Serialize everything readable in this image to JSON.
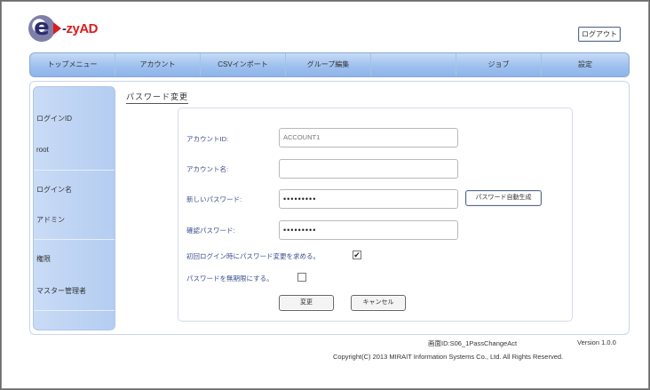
{
  "header": {
    "logo": {
      "e": "e",
      "text_dash": "-",
      "text_brand": "zyAD"
    },
    "logout_label": "ログアウト"
  },
  "nav": [
    {
      "label": "トップメニュー"
    },
    {
      "label": "アカウント"
    },
    {
      "label": "CSVインポート"
    },
    {
      "label": "グループ編集"
    },
    {
      "label": ""
    },
    {
      "label": "ジョブ"
    },
    {
      "label": "設定"
    }
  ],
  "sidebar": {
    "login_id_label": "ログインID",
    "login_id_value": "root",
    "login_name_label": "ログイン名",
    "login_name_value": "アドミン",
    "role_label": "権限",
    "role_value": "マスター管理者"
  },
  "page": {
    "title": "パスワード変更"
  },
  "form": {
    "account_id": {
      "label": "アカウントID:",
      "value": "ACCOUNT1"
    },
    "account_name": {
      "label": "アカウント名:",
      "value": ""
    },
    "new_password": {
      "label": "新しいパスワード:",
      "value": "•••••••••"
    },
    "generate_label": "パスワード自動生成",
    "confirm_password": {
      "label": "確認パスワード:",
      "value": "•••••••••"
    },
    "force_change": {
      "label": "初回ログイン時にパスワード変更を求める。",
      "checked": true,
      "mark": "✔"
    },
    "no_expire": {
      "label": "パスワードを無期限にする。",
      "checked": false,
      "mark": ""
    },
    "submit_label": "変更",
    "cancel_label": "キャンセル"
  },
  "footer": {
    "screen_id": "画面ID:S06_1PassChangeAct",
    "version": "Version 1.0.0",
    "copyright": "Copyright(C) 2013 MIRAIT Information Systems Co., Ltd. All Rights Reserved."
  }
}
